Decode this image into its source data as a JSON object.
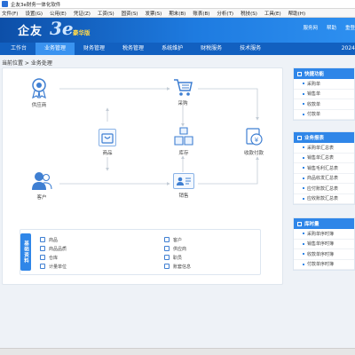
{
  "window": {
    "title": "企友3e财务一体化软件"
  },
  "menu": [
    "文件(F)",
    "设置(G)",
    "公用(E)",
    "凭证(Z)",
    "工资(S)",
    "固资(S)",
    "发票(S)",
    "期末(B)",
    "账表(B)",
    "分析(T)",
    "税技(S)",
    "工具(E)",
    "帮助(H)"
  ],
  "header": {
    "logo_text": "企友",
    "logo_number": "3e",
    "edition": "豪华版",
    "links": [
      "服务网",
      "帮助",
      "重登"
    ]
  },
  "nav": {
    "tabs": [
      {
        "label": "工作台",
        "active": false
      },
      {
        "label": "业务管理",
        "active": true
      },
      {
        "label": "财务管理",
        "active": false
      },
      {
        "label": "税务管理",
        "active": false
      },
      {
        "label": "系统维护",
        "active": false
      },
      {
        "label": "财税服务",
        "active": false
      },
      {
        "label": "技术服务",
        "active": false
      }
    ],
    "year": "2024"
  },
  "breadcrumb": "当前位置 > 业务处理",
  "flow": {
    "supplier": "供应商",
    "purchase": "采购",
    "product": "商品",
    "inventory": "库存",
    "receipt_payment": "收款付款",
    "customer": "客户",
    "sales": "销售"
  },
  "basic_data": {
    "tag": "基础资料",
    "left": [
      {
        "label": "商品",
        "icon": "product-icon"
      },
      {
        "label": "商品品质",
        "icon": "quality-icon"
      },
      {
        "label": "仓库",
        "icon": "warehouse-icon"
      },
      {
        "label": "计量单位",
        "icon": "unit-icon"
      }
    ],
    "right": [
      {
        "label": "客户",
        "icon": "customer-icon"
      },
      {
        "label": "供应商",
        "icon": "supplier-icon"
      },
      {
        "label": "职员",
        "icon": "staff-icon"
      },
      {
        "label": "账套信息",
        "icon": "account-info-icon"
      }
    ]
  },
  "side": {
    "quick": {
      "title": "快捷功能",
      "items": [
        "采购单",
        "销售单",
        "收款单",
        "付款单"
      ]
    },
    "reports": {
      "title": "业务报表",
      "items": [
        "采购单汇总表",
        "销售单汇总表",
        "销售毛利汇总表",
        "商品收发汇总表",
        "应付账款汇总表",
        "应收账款汇总表"
      ]
    },
    "timing": {
      "title": "库时量",
      "items": [
        "采购单序时簿",
        "销售单序时簿",
        "收款单序时簿",
        "付款单序时簿"
      ]
    }
  },
  "colors": {
    "primary": "#1260c0",
    "accent": "#2f86e8",
    "icon": "#3f7fd2"
  }
}
